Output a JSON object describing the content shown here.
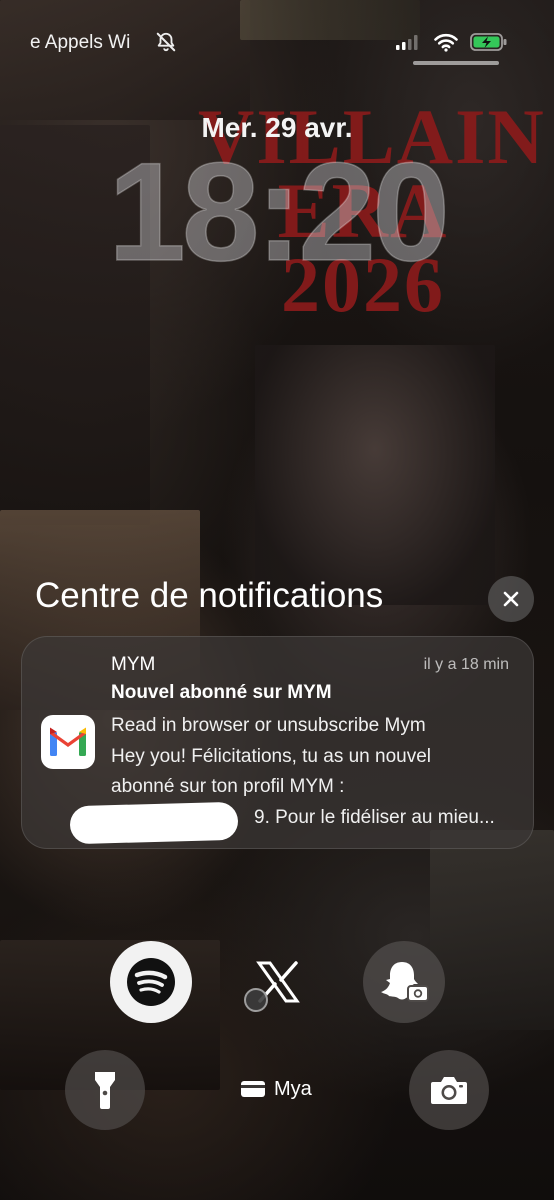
{
  "status_bar": {
    "carrier": "e Appels Wi",
    "icons": [
      "bell-slash-icon",
      "cellular-signal-icon",
      "wifi-icon",
      "battery-charging-icon"
    ],
    "battery_color": "#34c759"
  },
  "wallpaper": {
    "text_lines": [
      "VILLAIN",
      "ERA",
      "2026"
    ],
    "text_color": "#8a1b1b"
  },
  "lock": {
    "date": "Mer. 29 avr.",
    "time": "18:20"
  },
  "notification_center": {
    "title": "Centre de notifications",
    "close_icon": "close-x-icon",
    "notifications": [
      {
        "app": "MYM",
        "app_icon": "gmail-icon",
        "time": "il y a 18 min",
        "subject": "Nouvel abonné sur MYM",
        "body_lines": [
          "Read in browser or unsubscribe Mym",
          "Hey you! Félicitations, tu as un nouvel",
          "abonné sur ton profil MYM :",
          "9. Pour le fidéliser au mieu..."
        ]
      }
    ]
  },
  "widgets": {
    "spotify_icon": "spotify-icon",
    "x_icon": "x-logo-icon",
    "snapchat_icon": "snapchat-camera-icon",
    "wallet": {
      "label": "Mya",
      "icon": "wallet-card-icon"
    },
    "flashlight_icon": "flashlight-icon",
    "camera_icon": "camera-icon"
  }
}
